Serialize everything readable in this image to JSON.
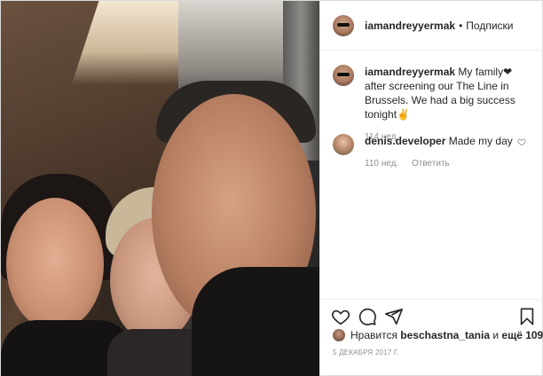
{
  "post": {
    "author": {
      "username": "iamandreyyermak",
      "separator": "•",
      "follow_label": "Подписки"
    },
    "caption": {
      "username": "iamandreyyermak",
      "text": "My family❤ after screening our The Line in Brussels. We had a big success tonight✌",
      "age": "114 нед."
    },
    "comments": [
      {
        "username": "denis.developer",
        "text": "Made my day",
        "age": "110 нед.",
        "reply_label": "Ответить"
      }
    ],
    "likes": {
      "prefix": "Нравится",
      "user": "beschastna_tania",
      "connector": "и",
      "others": "ещё 109"
    },
    "date": "5 ДЕКАБРЯ 2017 Г."
  },
  "icons": {
    "like": "heart-icon",
    "comment": "comment-icon",
    "share": "share-icon",
    "save": "bookmark-icon",
    "comment_like": "heart-icon"
  },
  "colors": {
    "text": "#262626",
    "secondary": "#8e8e8e",
    "border": "#dbdbdb"
  }
}
